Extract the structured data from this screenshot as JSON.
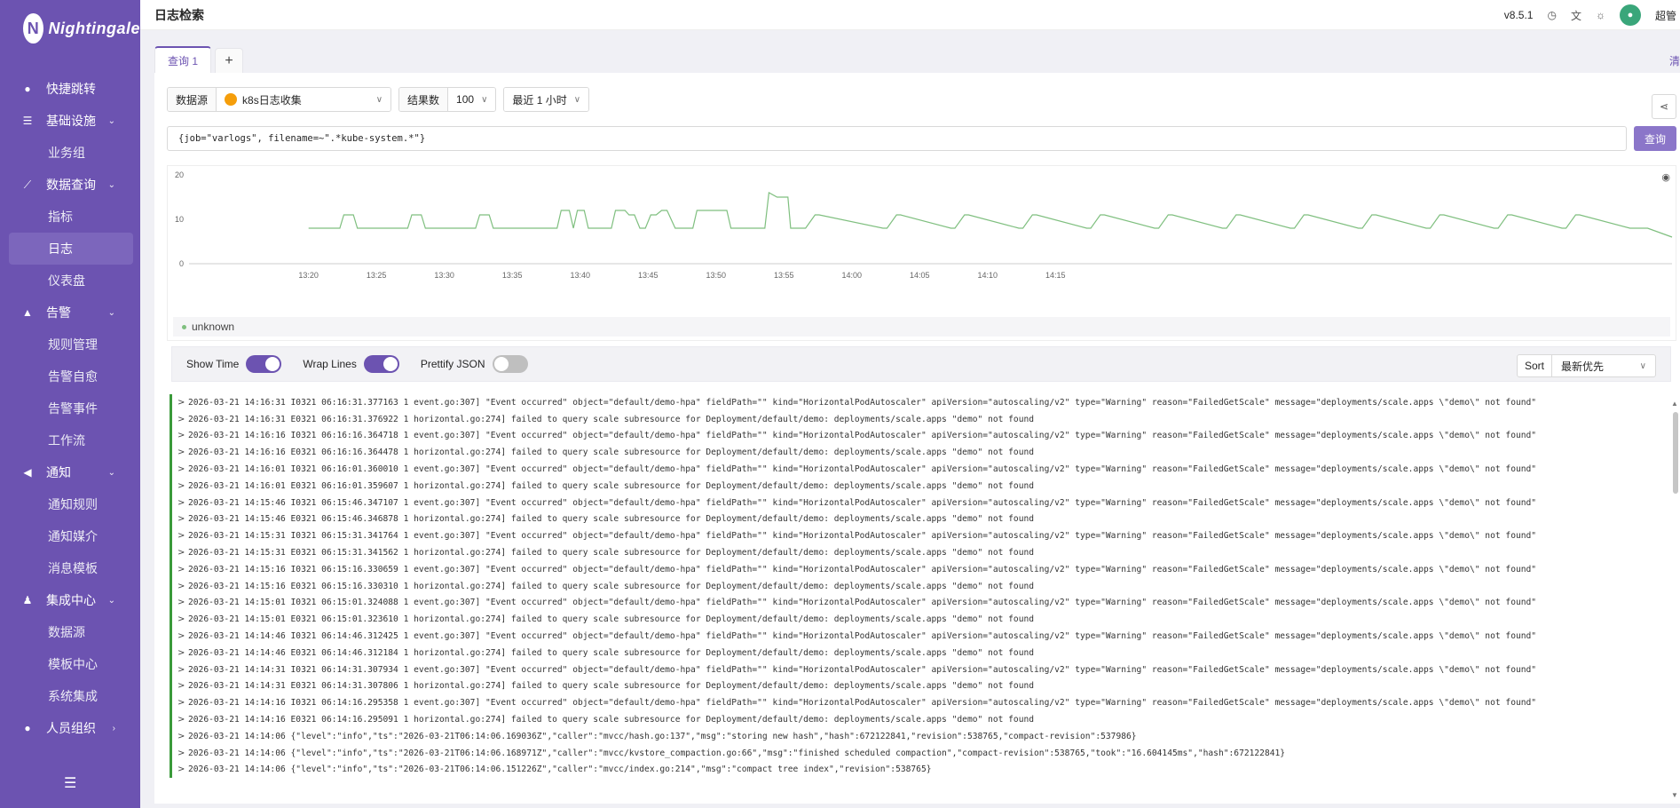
{
  "app": {
    "logo_text": "Nightingale",
    "logo_mark": "N"
  },
  "sidebar": {
    "items": [
      {
        "label": "快捷跳转",
        "icon": "search-icon",
        "glyph": "●",
        "type": "item"
      },
      {
        "label": "基础设施",
        "icon": "infrastructure-icon",
        "glyph": "☰",
        "type": "group",
        "chevron": "⌄"
      },
      {
        "label": "业务组",
        "type": "sub"
      },
      {
        "label": "数据查询",
        "icon": "chart-icon",
        "glyph": "⟋",
        "type": "group",
        "chevron": "⌄"
      },
      {
        "label": "指标",
        "type": "sub"
      },
      {
        "label": "日志",
        "type": "sub",
        "active": true
      },
      {
        "label": "仪表盘",
        "type": "sub"
      },
      {
        "label": "告警",
        "icon": "bell-icon",
        "glyph": "▲",
        "type": "group",
        "chevron": "⌄"
      },
      {
        "label": "规则管理",
        "type": "sub"
      },
      {
        "label": "告警自愈",
        "type": "sub"
      },
      {
        "label": "告警事件",
        "type": "sub"
      },
      {
        "label": "工作流",
        "type": "sub"
      },
      {
        "label": "通知",
        "icon": "megaphone-icon",
        "glyph": "◀",
        "type": "group",
        "chevron": "⌄"
      },
      {
        "label": "通知规则",
        "type": "sub"
      },
      {
        "label": "通知媒介",
        "type": "sub"
      },
      {
        "label": "消息模板",
        "type": "sub"
      },
      {
        "label": "集成中心",
        "icon": "integration-icon",
        "glyph": "♟",
        "type": "group",
        "chevron": "⌄"
      },
      {
        "label": "数据源",
        "type": "sub"
      },
      {
        "label": "模板中心",
        "type": "sub"
      },
      {
        "label": "系统集成",
        "type": "sub"
      },
      {
        "label": "人员组织",
        "icon": "user-icon",
        "glyph": "●",
        "type": "group",
        "chevron": "›"
      }
    ],
    "collapse_glyph": "☰"
  },
  "header": {
    "title": "日志检索",
    "version": "v8.5.1",
    "username": "超管"
  },
  "tabs": {
    "active_label": "查询 1",
    "add_label": "+",
    "clear_label": "清"
  },
  "filters": {
    "datasource_label": "数据源",
    "datasource_value": "k8s日志收集",
    "limit_label": "结果数",
    "limit_value": "100",
    "time_range": "最近 1 小时"
  },
  "query": {
    "text": "{job=\"varlogs\", filename=~\".*kube-system.*\"}",
    "button_label": "查询"
  },
  "chart_data": {
    "type": "line",
    "ylim": [
      0,
      20
    ],
    "yticks": [
      0,
      10,
      20
    ],
    "xticks": [
      "13:20",
      "13:25",
      "13:30",
      "13:35",
      "13:40",
      "13:45",
      "13:50",
      "13:55",
      "14:00",
      "14:05",
      "14:10",
      "14:15"
    ],
    "x_minutes": [
      0,
      2.3,
      2.6,
      3.3,
      3.6,
      7.3,
      7.6,
      8.3,
      8.6,
      12.3,
      12.6,
      13.3,
      13.6,
      18.3,
      18.6,
      19.2,
      19.5,
      19.8,
      20.3,
      20.6,
      22.3,
      22.6,
      23.3,
      23.6,
      24.0,
      24.4,
      24.8,
      25.2,
      25.6,
      26.0,
      26.4,
      27.0,
      27.4,
      28.3,
      28.6,
      30.8,
      31.1,
      31.5,
      31.8,
      32.3,
      33.6,
      33.9,
      34.5,
      34.8,
      35.0,
      35.3,
      35.5,
      36.3,
      36.6,
      37.3,
      37.6,
      42.3,
      42.6,
      43.3,
      43.6,
      47.3,
      47.6,
      48.3,
      48.6,
      52.3,
      52.6,
      53.3,
      53.6,
      57.3,
      57.6,
      58.3,
      58.6,
      62.3,
      62.6,
      63.3,
      63.6,
      67.3,
      67.6,
      68.3,
      68.6,
      72.3,
      72.6,
      73.3,
      73.6,
      77.3,
      77.6,
      78.3,
      78.6,
      82.3,
      82.6,
      83.3,
      83.6,
      87.3,
      87.6,
      88.3,
      88.6,
      92.3,
      92.6,
      93.3,
      93.6,
      97.3,
      97.6,
      98.3,
      98.6,
      100.4
    ],
    "series": [
      {
        "name": "unknown",
        "color": "#7fbf7f",
        "values": [
          8,
          8,
          11,
          11,
          8,
          8,
          11,
          11,
          8,
          8,
          11,
          11,
          8,
          8,
          12,
          12,
          8,
          12,
          12,
          8,
          8,
          12,
          12,
          11,
          11,
          8,
          8,
          11,
          11,
          12,
          12,
          8,
          8,
          8,
          12,
          12,
          8,
          8,
          8,
          8,
          8,
          16,
          15,
          15,
          15,
          15,
          8,
          8,
          8,
          11,
          11,
          8,
          8,
          11,
          11,
          8,
          8,
          11,
          11,
          8,
          8,
          11,
          11,
          8,
          8,
          11,
          11,
          8,
          8,
          11,
          11,
          8,
          8,
          11,
          11,
          8,
          8,
          11,
          11,
          8,
          8,
          11,
          11,
          8,
          8,
          11,
          11,
          8,
          8,
          11,
          11,
          8,
          8,
          11,
          11,
          8,
          8,
          8,
          8,
          6
        ]
      }
    ]
  },
  "log_toolbar": {
    "show_time_label": "Show Time",
    "show_time_on": true,
    "wrap_lines_label": "Wrap Lines",
    "wrap_lines_on": true,
    "prettify_label": "Prettify JSON",
    "prettify_on": false,
    "sort_label": "Sort",
    "sort_value": "最新优先"
  },
  "logs": [
    "2026-03-21 14:16:31 I0321 06:16:31.377163       1 event.go:307] \"Event occurred\" object=\"default/demo-hpa\" fieldPath=\"\" kind=\"HorizontalPodAutoscaler\" apiVersion=\"autoscaling/v2\" type=\"Warning\" reason=\"FailedGetScale\" message=\"deployments/scale.apps \\\"demo\\\" not found\"",
    "2026-03-21 14:16:31 E0321 06:16:31.376922       1 horizontal.go:274] failed to query scale subresource for Deployment/default/demo: deployments/scale.apps \"demo\" not found",
    "2026-03-21 14:16:16 I0321 06:16:16.364718       1 event.go:307] \"Event occurred\" object=\"default/demo-hpa\" fieldPath=\"\" kind=\"HorizontalPodAutoscaler\" apiVersion=\"autoscaling/v2\" type=\"Warning\" reason=\"FailedGetScale\" message=\"deployments/scale.apps \\\"demo\\\" not found\"",
    "2026-03-21 14:16:16 E0321 06:16:16.364478       1 horizontal.go:274] failed to query scale subresource for Deployment/default/demo: deployments/scale.apps \"demo\" not found",
    "2026-03-21 14:16:01 I0321 06:16:01.360010       1 event.go:307] \"Event occurred\" object=\"default/demo-hpa\" fieldPath=\"\" kind=\"HorizontalPodAutoscaler\" apiVersion=\"autoscaling/v2\" type=\"Warning\" reason=\"FailedGetScale\" message=\"deployments/scale.apps \\\"demo\\\" not found\"",
    "2026-03-21 14:16:01 E0321 06:16:01.359607       1 horizontal.go:274] failed to query scale subresource for Deployment/default/demo: deployments/scale.apps \"demo\" not found",
    "2026-03-21 14:15:46 I0321 06:15:46.347107       1 event.go:307] \"Event occurred\" object=\"default/demo-hpa\" fieldPath=\"\" kind=\"HorizontalPodAutoscaler\" apiVersion=\"autoscaling/v2\" type=\"Warning\" reason=\"FailedGetScale\" message=\"deployments/scale.apps \\\"demo\\\" not found\"",
    "2026-03-21 14:15:46 E0321 06:15:46.346878       1 horizontal.go:274] failed to query scale subresource for Deployment/default/demo: deployments/scale.apps \"demo\" not found",
    "2026-03-21 14:15:31 I0321 06:15:31.341764       1 event.go:307] \"Event occurred\" object=\"default/demo-hpa\" fieldPath=\"\" kind=\"HorizontalPodAutoscaler\" apiVersion=\"autoscaling/v2\" type=\"Warning\" reason=\"FailedGetScale\" message=\"deployments/scale.apps \\\"demo\\\" not found\"",
    "2026-03-21 14:15:31 E0321 06:15:31.341562       1 horizontal.go:274] failed to query scale subresource for Deployment/default/demo: deployments/scale.apps \"demo\" not found",
    "2026-03-21 14:15:16 I0321 06:15:16.330659       1 event.go:307] \"Event occurred\" object=\"default/demo-hpa\" fieldPath=\"\" kind=\"HorizontalPodAutoscaler\" apiVersion=\"autoscaling/v2\" type=\"Warning\" reason=\"FailedGetScale\" message=\"deployments/scale.apps \\\"demo\\\" not found\"",
    "2026-03-21 14:15:16 E0321 06:15:16.330310       1 horizontal.go:274] failed to query scale subresource for Deployment/default/demo: deployments/scale.apps \"demo\" not found",
    "2026-03-21 14:15:01 I0321 06:15:01.324088       1 event.go:307] \"Event occurred\" object=\"default/demo-hpa\" fieldPath=\"\" kind=\"HorizontalPodAutoscaler\" apiVersion=\"autoscaling/v2\" type=\"Warning\" reason=\"FailedGetScale\" message=\"deployments/scale.apps \\\"demo\\\" not found\"",
    "2026-03-21 14:15:01 E0321 06:15:01.323610       1 horizontal.go:274] failed to query scale subresource for Deployment/default/demo: deployments/scale.apps \"demo\" not found",
    "2026-03-21 14:14:46 I0321 06:14:46.312425       1 event.go:307] \"Event occurred\" object=\"default/demo-hpa\" fieldPath=\"\" kind=\"HorizontalPodAutoscaler\" apiVersion=\"autoscaling/v2\" type=\"Warning\" reason=\"FailedGetScale\" message=\"deployments/scale.apps \\\"demo\\\" not found\"",
    "2026-03-21 14:14:46 E0321 06:14:46.312184       1 horizontal.go:274] failed to query scale subresource for Deployment/default/demo: deployments/scale.apps \"demo\" not found",
    "2026-03-21 14:14:31 I0321 06:14:31.307934       1 event.go:307] \"Event occurred\" object=\"default/demo-hpa\" fieldPath=\"\" kind=\"HorizontalPodAutoscaler\" apiVersion=\"autoscaling/v2\" type=\"Warning\" reason=\"FailedGetScale\" message=\"deployments/scale.apps \\\"demo\\\" not found\"",
    "2026-03-21 14:14:31 E0321 06:14:31.307806       1 horizontal.go:274] failed to query scale subresource for Deployment/default/demo: deployments/scale.apps \"demo\" not found",
    "2026-03-21 14:14:16 I0321 06:14:16.295358       1 event.go:307] \"Event occurred\" object=\"default/demo-hpa\" fieldPath=\"\" kind=\"HorizontalPodAutoscaler\" apiVersion=\"autoscaling/v2\" type=\"Warning\" reason=\"FailedGetScale\" message=\"deployments/scale.apps \\\"demo\\\" not found\"",
    "2026-03-21 14:14:16 E0321 06:14:16.295091       1 horizontal.go:274] failed to query scale subresource for Deployment/default/demo: deployments/scale.apps \"demo\" not found",
    "2026-03-21 14:14:06 {\"level\":\"info\",\"ts\":\"2026-03-21T06:14:06.169036Z\",\"caller\":\"mvcc/hash.go:137\",\"msg\":\"storing new hash\",\"hash\":672122841,\"revision\":538765,\"compact-revision\":537986}",
    "2026-03-21 14:14:06 {\"level\":\"info\",\"ts\":\"2026-03-21T06:14:06.168971Z\",\"caller\":\"mvcc/kvstore_compaction.go:66\",\"msg\":\"finished scheduled compaction\",\"compact-revision\":538765,\"took\":\"16.604145ms\",\"hash\":672122841}",
    "2026-03-21 14:14:06 {\"level\":\"info\",\"ts\":\"2026-03-21T06:14:06.151226Z\",\"caller\":\"mvcc/index.go:214\",\"msg\":\"compact tree index\",\"revision\":538765}"
  ]
}
